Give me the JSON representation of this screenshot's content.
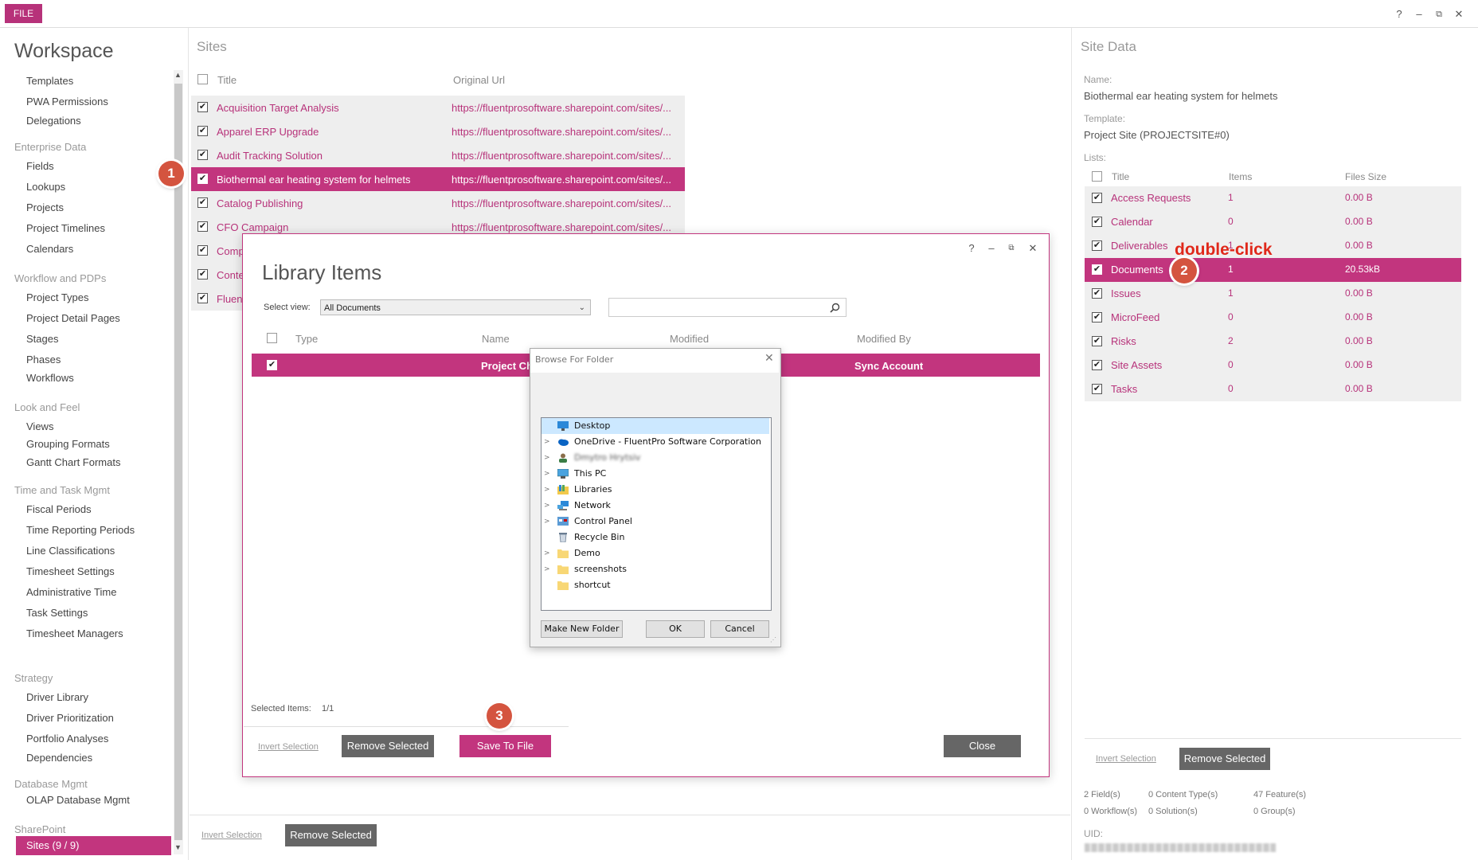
{
  "topbar": {
    "file_label": "FILE",
    "help": "?",
    "minimize": "–",
    "restore": "⧉",
    "close": "✕"
  },
  "workspace": {
    "title": "Workspace",
    "groups": [
      {
        "label": "",
        "items": [
          "Templates",
          "PWA Permissions",
          "Delegations"
        ]
      },
      {
        "label": "Enterprise Data",
        "items": [
          "Fields",
          "Lookups",
          "Projects",
          "Project Timelines",
          "Calendars"
        ]
      },
      {
        "label": "Workflow and PDPs",
        "items": [
          "Project Types",
          "Project Detail Pages",
          "Stages",
          "Phases",
          "Workflows"
        ]
      },
      {
        "label": "Look and Feel",
        "items": [
          "Views",
          "Grouping Formats",
          "Gantt Chart Formats"
        ]
      },
      {
        "label": "Time and Task Mgmt",
        "items": [
          "Fiscal Periods",
          "Time Reporting Periods",
          "Line Classifications",
          "Timesheet Settings",
          "Administrative Time",
          "Task Settings",
          "Timesheet Managers"
        ]
      },
      {
        "label": "Strategy",
        "items": [
          "Driver Library",
          "Driver Prioritization",
          "Portfolio Analyses",
          "Dependencies"
        ]
      },
      {
        "label": "Database Mgmt",
        "items": [
          "OLAP Database Mgmt"
        ]
      },
      {
        "label": "SharePoint",
        "items": [
          "Sites (9 / 9)"
        ]
      }
    ]
  },
  "sites": {
    "title": "Sites",
    "col_title": "Title",
    "col_url": "Original Url",
    "rows": [
      {
        "title": "Acquisition Target Analysis",
        "url": "https://fluentprosoftware.sharepoint.com/sites/..."
      },
      {
        "title": "Apparel ERP Upgrade",
        "url": "https://fluentprosoftware.sharepoint.com/sites/..."
      },
      {
        "title": "Audit Tracking Solution",
        "url": "https://fluentprosoftware.sharepoint.com/sites/..."
      },
      {
        "title": "Biothermal ear heating system for helmets",
        "url": "https://fluentprosoftware.sharepoint.com/sites/..."
      },
      {
        "title": "Catalog Publishing",
        "url": "https://fluentprosoftware.sharepoint.com/sites/..."
      },
      {
        "title": "CFO Campaign",
        "url": "https://fluentprosoftware.sharepoint.com/sites/..."
      },
      {
        "title": "Comp",
        "url": ""
      },
      {
        "title": "Conte",
        "url": ""
      },
      {
        "title": "Fluent",
        "url": ""
      }
    ],
    "invert_selection": "Invert Selection",
    "remove_selected": "Remove Selected"
  },
  "site_data": {
    "title": "Site Data",
    "name_label": "Name:",
    "name_value": "Biothermal ear heating system for helmets",
    "template_label": "Template:",
    "template_value": "Project Site (PROJECTSITE#0)",
    "lists_label": "Lists:",
    "col_title": "Title",
    "col_items": "Items",
    "col_size": "Files Size",
    "lists": [
      {
        "title": "Access Requests",
        "items": "1",
        "size": "0.00 B"
      },
      {
        "title": "Calendar",
        "items": "0",
        "size": "0.00 B"
      },
      {
        "title": "Deliverables",
        "items": "1",
        "size": "0.00 B"
      },
      {
        "title": "Documents",
        "items": "1",
        "size": "20.53kB"
      },
      {
        "title": "Issues",
        "items": "1",
        "size": "0.00 B"
      },
      {
        "title": "MicroFeed",
        "items": "0",
        "size": "0.00 B"
      },
      {
        "title": "Risks",
        "items": "2",
        "size": "0.00 B"
      },
      {
        "title": "Site Assets",
        "items": "0",
        "size": "0.00 B"
      },
      {
        "title": "Tasks",
        "items": "0",
        "size": "0.00 B"
      }
    ],
    "invert_selection": "Invert Selection",
    "remove_selected": "Remove Selected",
    "stats": {
      "fields": "2 Field(s)",
      "content_types": "0 Content Type(s)",
      "features": "47 Feature(s)",
      "workflows": "0 Workflow(s)",
      "solutions": "0 Solution(s)",
      "groups": "0 Group(s)"
    },
    "uid_label": "UID:"
  },
  "annotations": {
    "step1": "1",
    "step2": "2",
    "step3": "3",
    "double_click": "double-click"
  },
  "library_dialog": {
    "title": "Library Items",
    "help": "?",
    "minimize": "–",
    "restore": "⧉",
    "close": "✕",
    "select_view_label": "Select view:",
    "select_view_value": "All Documents",
    "col_type": "Type",
    "col_name": "Name",
    "col_modified": "Modified",
    "col_modified_by": "Modified By",
    "row_name": "Project Ch",
    "row_modified_by": "Sync Account",
    "selected_items_label": "Selected Items:",
    "selected_items_value": "1/1",
    "invert_selection": "Invert Selection",
    "remove_selected": "Remove Selected",
    "save_to_file": "Save To File",
    "close_button": "Close"
  },
  "browse_folder": {
    "title": "Browse For Folder",
    "tree": [
      {
        "label": "Desktop",
        "icon": "desktop-icon",
        "expandable": false,
        "selected": true
      },
      {
        "label": "OneDrive - FluentPro Software Corporation",
        "icon": "cloud-icon",
        "expandable": true
      },
      {
        "label": "Dmytro Hrytsiv",
        "icon": "user-icon",
        "expandable": true
      },
      {
        "label": "This PC",
        "icon": "computer-icon",
        "expandable": true
      },
      {
        "label": "Libraries",
        "icon": "library-icon",
        "expandable": true
      },
      {
        "label": "Network",
        "icon": "network-icon",
        "expandable": true
      },
      {
        "label": "Control Panel",
        "icon": "control-panel-icon",
        "expandable": true
      },
      {
        "label": "Recycle Bin",
        "icon": "recycle-bin-icon",
        "expandable": false
      },
      {
        "label": "Demo",
        "icon": "folder-icon",
        "expandable": true
      },
      {
        "label": "screenshots",
        "icon": "folder-icon",
        "expandable": true
      },
      {
        "label": "shortcut",
        "icon": "folder-icon",
        "expandable": false
      }
    ],
    "make_new_folder": "Make New Folder",
    "ok": "OK",
    "cancel": "Cancel"
  },
  "colors": {
    "accent": "#c2357e",
    "badge": "#d4543f",
    "annotation_text": "#e0281a"
  }
}
